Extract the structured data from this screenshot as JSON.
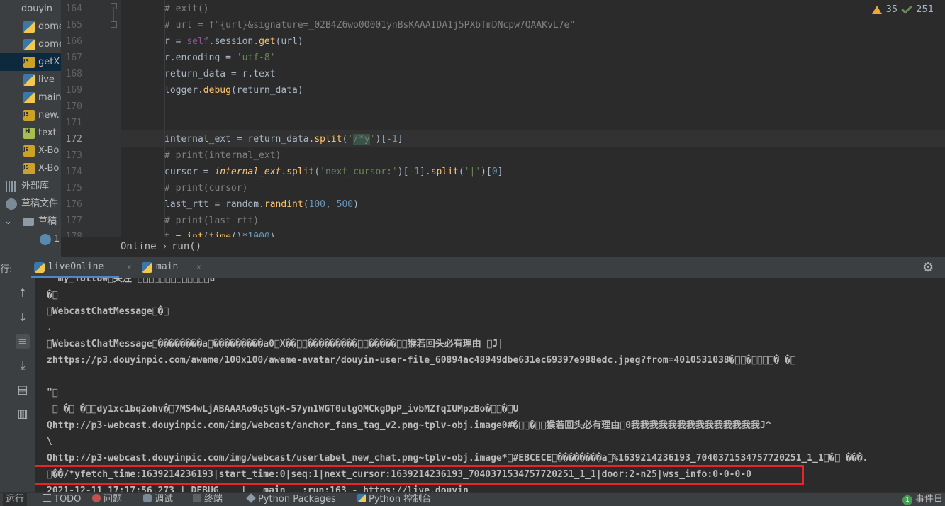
{
  "project_tree": {
    "items": [
      {
        "label": "douyin",
        "icon": "folder-icon",
        "chevron": "⌄"
      },
      {
        "label": "dome",
        "icon": "python-file-icon"
      },
      {
        "label": "dome",
        "icon": "python-file-icon"
      },
      {
        "label": "getX",
        "icon": "js-file-icon"
      },
      {
        "label": "live",
        "icon": "python-file-icon"
      },
      {
        "label": "main",
        "icon": "python-file-icon"
      },
      {
        "label": "new.",
        "icon": "js-file-icon"
      },
      {
        "label": "text",
        "icon": "html-file-icon"
      },
      {
        "label": "X-Bo",
        "icon": "js-file-icon"
      },
      {
        "label": "X-Bo",
        "icon": "js-file-icon"
      },
      {
        "label": "外部库",
        "icon": "library-icon"
      },
      {
        "label": "草稿文件",
        "icon": "scratch-icon"
      },
      {
        "label": "草稿",
        "icon": "folder-icon",
        "chevron": "⌄"
      },
      {
        "label": "1",
        "icon": "user-icon"
      }
    ]
  },
  "editor": {
    "line_numbers": [
      "164",
      "165",
      "166",
      "167",
      "168",
      "169",
      "170",
      "171",
      "172",
      "173",
      "174",
      "175",
      "176",
      "177",
      "178"
    ],
    "current_line": "172",
    "inspections": {
      "warnings": "35",
      "ok": "251"
    },
    "code": {
      "l164": "# exit()",
      "l165": "# url = f\"{url}&signature=_02B4Z6wo00001ynBsKAAAIDA1j5PXbTmDNcpw7QAAKvL7e\"",
      "l166": {
        "a": "r = ",
        "b": "self",
        "c": ".session.",
        "d": "get",
        "e": "(url)"
      },
      "l167": {
        "a": "r.encoding = ",
        "b": "'utf-8'"
      },
      "l168": {
        "a": "return_data = r.text"
      },
      "l169": {
        "a": "logger.",
        "b": "debug",
        "c": "(return_data)"
      },
      "l172": {
        "a": "internal_ext = return_data.",
        "b": "split",
        "c": "(",
        "d": "'",
        "e": "/*y",
        "f": "'",
        "g": ")[",
        "h": "-1",
        "i": "]"
      },
      "l173": "# print(internal_ext)",
      "l174": {
        "a": "cursor = ",
        "b": "internal_ext",
        "c": ".",
        "d": "split",
        "e": "(",
        "f": "'next_cursor:'",
        "g": ")[",
        "h": "-1",
        "i": "].",
        "j": "split",
        "k": "(",
        "l": "'|'",
        "m": ")[",
        "n": "0",
        "o": "]"
      },
      "l175": "# print(cursor)",
      "l176": {
        "a": "last_rtt = random.",
        "b": "randint",
        "c": "(",
        "d": "100",
        "e": ", ",
        "f": "500",
        "g": ")"
      },
      "l177": "# print(last_rtt)",
      "l178": {
        "a": "t = ",
        "b": "int",
        "c": "(",
        "d": "time",
        "e": "()*",
        "f": "1000",
        "g": ")"
      }
    },
    "breadcrumb": {
      "class": "Online",
      "separator": "›",
      "method": "run()"
    }
  },
  "run_panel": {
    "label": "行:",
    "tabs": [
      {
        "label": "liveOnline",
        "active": true,
        "close": "×"
      },
      {
        "label": "main",
        "active": false,
        "close": "×"
      }
    ],
    "settings_icon": "gear-icon",
    "console_lines": [
      "  my_follow\u0000关注 \u0000\u0000\u0000\u0000\u0000\u0000\u0000\u0000\u0000\u0000\u0000\u0000\u0000u",
      "�\u0000",
      "\u0000WebcastChatMessage\u0000�\u0000",
      ".",
      "\u0000WebcastChatMessage\u0000��������a\u0000���������a0\u0000X��\u0000\u0000���������\u0000\u0000�����\u0000\u0000猴若回头必有理由 \u0000J|",
      "zhttps://p3.douyinpic.com/aweme/100x100/aweme-avatar/douyin-user-file_60894ac48949dbe631ec69397e988edc.jpeg?from=4010531038�\u0000\u0000�\u0000\u0000\u0000\u0000� �\u0000",
      "",
      "\"\u0000",
      " \u0000 �\u0000 �\u0000\u0000dy1xc1bq2ohv�\u00007MS4wLjABAAAAo9q5lgK-57yn1WGT0ulgQMCkgDpP_ivbMZfqIUMpzBo�\u0000\u0000�\u0000U",
      "Qhttp://p3-webcast.douyinpic.com/img/webcast/anchor_fans_tag_v2.png~tplv-obj.image0#�\u0000\u0000�\u0000\u0000猴若回头必有理由\u00000我我我我我我我我我我我我我我J^",
      "\\",
      "Qhttp://p3-webcast.douyinpic.com/img/webcast/userlabel_new_chat.png~tplv-obj.image*\u0000#EBCECE\u0000��������a\u0000%1639214236193_7040371534757720251_1_1\u0000�\u0000 ���.",
      "\u0000��/*yfetch_time:1639214236193|start_time:0|seq:1|next_cursor:1639214236193_7040371534757720251_1_1|door:2-n25|wss_info:0-0-0-0",
      "2021-12-11 17:17:56,273 | DEBUG    |   main   :run:163 - https://live.douyin"
    ],
    "highlight_line_index": 12
  },
  "status_bar": {
    "items": [
      {
        "label": "运行",
        "icon": null,
        "active": true
      },
      {
        "label": "TODO",
        "icon": "todo-icon"
      },
      {
        "label": "问题",
        "icon": "error-icon"
      },
      {
        "label": "调试",
        "icon": "bug-icon"
      },
      {
        "label": "终端",
        "icon": "terminal-icon"
      },
      {
        "label": "Python Packages",
        "icon": "packages-icon"
      },
      {
        "label": "Python 控制台",
        "icon": "python-console-icon"
      }
    ],
    "event_log": {
      "count": "1",
      "label": "事件日"
    }
  }
}
